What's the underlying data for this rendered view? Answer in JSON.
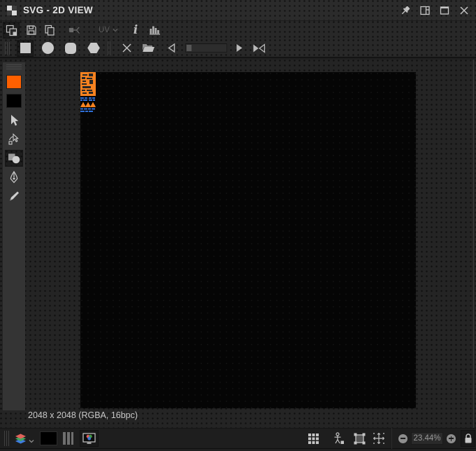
{
  "titlebar": {
    "title": "SVG - 2D VIEW",
    "icons": [
      "app-checker-icon",
      "pin-icon",
      "split-view-icon",
      "maximize-icon",
      "close-icon"
    ]
  },
  "toolbar_main": {
    "icons": [
      "export-image-icon",
      "save-icon",
      "copy-icon",
      "node-link-icon",
      "uv-dropdown",
      "info-icon",
      "histogram-icon"
    ],
    "uv_label": "UV",
    "info_glyph": "i",
    "disabled_items": [
      "node-link-icon",
      "uv-dropdown"
    ],
    "active_item": "export-image-icon"
  },
  "toolbar_shapes": {
    "icons": [
      "square-shape-button",
      "circle-shape-button",
      "rounded-square-shape-button",
      "hexagon-shape-button",
      "clear-icon",
      "open-folder-icon",
      "prev-arrow-icon",
      "seek-slider",
      "next-arrow-icon",
      "mirror-icon"
    ],
    "selected_shape": "square"
  },
  "sidebar": {
    "foreground_color": "#ff6000",
    "background_color": "#000000",
    "tools": [
      "select-tool",
      "direct-select-tool",
      "shapes-tool",
      "pen-tool",
      "pencil-tool"
    ],
    "active_tool": "shapes-tool"
  },
  "canvas": {
    "background_color": "#050505",
    "emblem_colors": {
      "orange": "#f58220",
      "blue": "#2e6fd8",
      "dark": "#262626"
    }
  },
  "statusbar": {
    "image_info": "2048 x 2048 (RGBA, 16bpc)"
  },
  "bottombar": {
    "left_icons": [
      "layers-icon",
      "layers-chevron-icon",
      "background-swatch",
      "channels-icon",
      "display-color-icon"
    ],
    "right_icons": [
      "grid-icon",
      "physical-size-icon",
      "fit-view-icon",
      "pan-reset-icon",
      "zoom-out-button",
      "zoom-field",
      "zoom-in-button",
      "lock-icon"
    ],
    "zoom_value": "23.44%",
    "layer_colors": [
      "#e0635a",
      "#43a55f",
      "#3f7de0"
    ],
    "rgb_dot_colors": [
      "#e05a5a",
      "#4aa34a",
      "#3f7de0"
    ]
  }
}
